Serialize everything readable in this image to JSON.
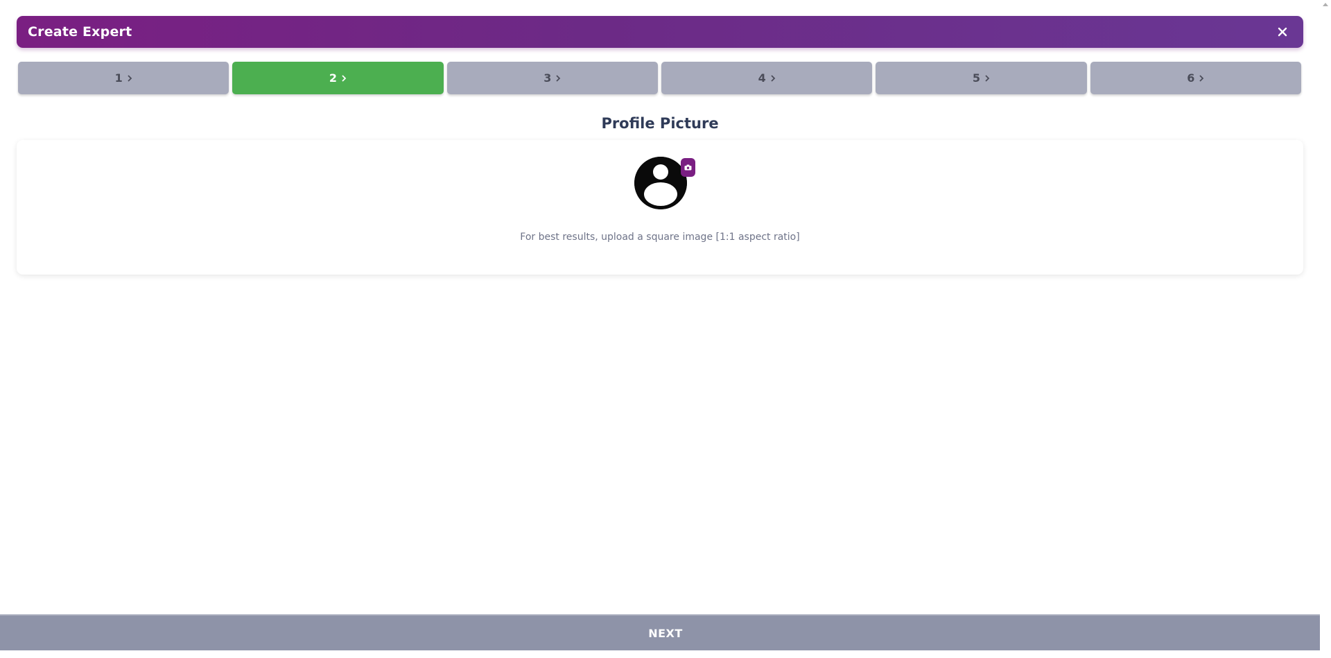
{
  "header": {
    "title": "Create Expert",
    "close_icon": "close-icon"
  },
  "stepper": {
    "active_index": 1,
    "steps": [
      {
        "label": "1"
      },
      {
        "label": "2"
      },
      {
        "label": "3"
      },
      {
        "label": "4"
      },
      {
        "label": "5"
      },
      {
        "label": "6"
      }
    ]
  },
  "section": {
    "title": "Profile Picture"
  },
  "upload": {
    "avatar_icon": "user-avatar-icon",
    "camera_icon": "camera-icon",
    "hint": "For best results, upload a square image [1:1 aspect ratio]"
  },
  "footer": {
    "next_label": "NEXT"
  },
  "colors": {
    "brand_purple": "#7a1f82",
    "active_step": "#4caf50",
    "inactive_step": "#a8abbc",
    "next_button": "#8e93a8"
  }
}
